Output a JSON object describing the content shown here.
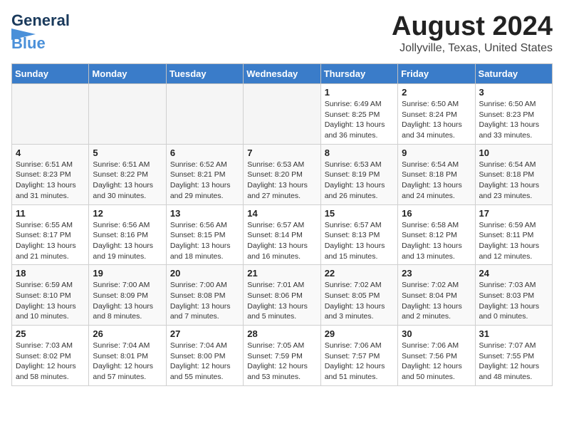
{
  "header": {
    "logo_line1": "General",
    "logo_line2": "Blue",
    "main_title": "August 2024",
    "subtitle": "Jollyville, Texas, United States"
  },
  "calendar": {
    "days_of_week": [
      "Sunday",
      "Monday",
      "Tuesday",
      "Wednesday",
      "Thursday",
      "Friday",
      "Saturday"
    ],
    "weeks": [
      [
        {
          "day": "",
          "info": ""
        },
        {
          "day": "",
          "info": ""
        },
        {
          "day": "",
          "info": ""
        },
        {
          "day": "",
          "info": ""
        },
        {
          "day": "1",
          "info": "Sunrise: 6:49 AM\nSunset: 8:25 PM\nDaylight: 13 hours\nand 36 minutes."
        },
        {
          "day": "2",
          "info": "Sunrise: 6:50 AM\nSunset: 8:24 PM\nDaylight: 13 hours\nand 34 minutes."
        },
        {
          "day": "3",
          "info": "Sunrise: 6:50 AM\nSunset: 8:23 PM\nDaylight: 13 hours\nand 33 minutes."
        }
      ],
      [
        {
          "day": "4",
          "info": "Sunrise: 6:51 AM\nSunset: 8:23 PM\nDaylight: 13 hours\nand 31 minutes."
        },
        {
          "day": "5",
          "info": "Sunrise: 6:51 AM\nSunset: 8:22 PM\nDaylight: 13 hours\nand 30 minutes."
        },
        {
          "day": "6",
          "info": "Sunrise: 6:52 AM\nSunset: 8:21 PM\nDaylight: 13 hours\nand 29 minutes."
        },
        {
          "day": "7",
          "info": "Sunrise: 6:53 AM\nSunset: 8:20 PM\nDaylight: 13 hours\nand 27 minutes."
        },
        {
          "day": "8",
          "info": "Sunrise: 6:53 AM\nSunset: 8:19 PM\nDaylight: 13 hours\nand 26 minutes."
        },
        {
          "day": "9",
          "info": "Sunrise: 6:54 AM\nSunset: 8:18 PM\nDaylight: 13 hours\nand 24 minutes."
        },
        {
          "day": "10",
          "info": "Sunrise: 6:54 AM\nSunset: 8:18 PM\nDaylight: 13 hours\nand 23 minutes."
        }
      ],
      [
        {
          "day": "11",
          "info": "Sunrise: 6:55 AM\nSunset: 8:17 PM\nDaylight: 13 hours\nand 21 minutes."
        },
        {
          "day": "12",
          "info": "Sunrise: 6:56 AM\nSunset: 8:16 PM\nDaylight: 13 hours\nand 19 minutes."
        },
        {
          "day": "13",
          "info": "Sunrise: 6:56 AM\nSunset: 8:15 PM\nDaylight: 13 hours\nand 18 minutes."
        },
        {
          "day": "14",
          "info": "Sunrise: 6:57 AM\nSunset: 8:14 PM\nDaylight: 13 hours\nand 16 minutes."
        },
        {
          "day": "15",
          "info": "Sunrise: 6:57 AM\nSunset: 8:13 PM\nDaylight: 13 hours\nand 15 minutes."
        },
        {
          "day": "16",
          "info": "Sunrise: 6:58 AM\nSunset: 8:12 PM\nDaylight: 13 hours\nand 13 minutes."
        },
        {
          "day": "17",
          "info": "Sunrise: 6:59 AM\nSunset: 8:11 PM\nDaylight: 13 hours\nand 12 minutes."
        }
      ],
      [
        {
          "day": "18",
          "info": "Sunrise: 6:59 AM\nSunset: 8:10 PM\nDaylight: 13 hours\nand 10 minutes."
        },
        {
          "day": "19",
          "info": "Sunrise: 7:00 AM\nSunset: 8:09 PM\nDaylight: 13 hours\nand 8 minutes."
        },
        {
          "day": "20",
          "info": "Sunrise: 7:00 AM\nSunset: 8:08 PM\nDaylight: 13 hours\nand 7 minutes."
        },
        {
          "day": "21",
          "info": "Sunrise: 7:01 AM\nSunset: 8:06 PM\nDaylight: 13 hours\nand 5 minutes."
        },
        {
          "day": "22",
          "info": "Sunrise: 7:02 AM\nSunset: 8:05 PM\nDaylight: 13 hours\nand 3 minutes."
        },
        {
          "day": "23",
          "info": "Sunrise: 7:02 AM\nSunset: 8:04 PM\nDaylight: 13 hours\nand 2 minutes."
        },
        {
          "day": "24",
          "info": "Sunrise: 7:03 AM\nSunset: 8:03 PM\nDaylight: 13 hours\nand 0 minutes."
        }
      ],
      [
        {
          "day": "25",
          "info": "Sunrise: 7:03 AM\nSunset: 8:02 PM\nDaylight: 12 hours\nand 58 minutes."
        },
        {
          "day": "26",
          "info": "Sunrise: 7:04 AM\nSunset: 8:01 PM\nDaylight: 12 hours\nand 57 minutes."
        },
        {
          "day": "27",
          "info": "Sunrise: 7:04 AM\nSunset: 8:00 PM\nDaylight: 12 hours\nand 55 minutes."
        },
        {
          "day": "28",
          "info": "Sunrise: 7:05 AM\nSunset: 7:59 PM\nDaylight: 12 hours\nand 53 minutes."
        },
        {
          "day": "29",
          "info": "Sunrise: 7:06 AM\nSunset: 7:57 PM\nDaylight: 12 hours\nand 51 minutes."
        },
        {
          "day": "30",
          "info": "Sunrise: 7:06 AM\nSunset: 7:56 PM\nDaylight: 12 hours\nand 50 minutes."
        },
        {
          "day": "31",
          "info": "Sunrise: 7:07 AM\nSunset: 7:55 PM\nDaylight: 12 hours\nand 48 minutes."
        }
      ]
    ]
  }
}
